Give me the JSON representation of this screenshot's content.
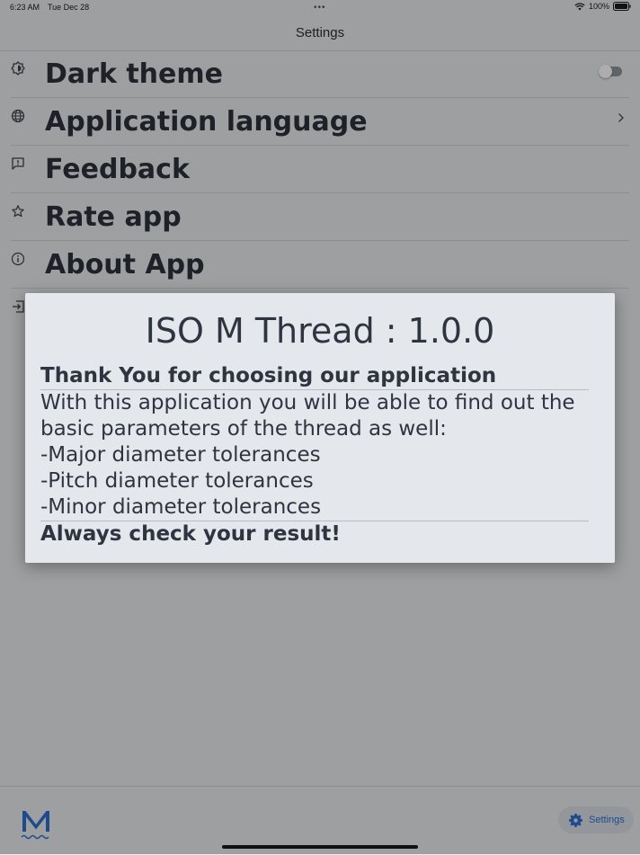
{
  "status_bar": {
    "time": "6:23 AM",
    "date": "Tue Dec 28",
    "dots": "•••",
    "battery": "100%"
  },
  "header": {
    "title": "Settings"
  },
  "settings": {
    "items": [
      {
        "label": "Dark theme",
        "icon": "brightness-icon",
        "control": "toggle",
        "toggle_on": false
      },
      {
        "label": "Application language",
        "icon": "globe-icon",
        "control": "chevron"
      },
      {
        "label": "Feedback",
        "icon": "feedback-icon",
        "control": "none"
      },
      {
        "label": "Rate app",
        "icon": "star-icon",
        "control": "none"
      },
      {
        "label": "About App",
        "icon": "info-icon",
        "control": "none"
      },
      {
        "label": "",
        "icon": "exit-icon",
        "control": "none"
      }
    ]
  },
  "dialog": {
    "title": "ISO M Thread : 1.0.0",
    "heading": "Thank You for choosing our application",
    "intro": "With this application you will be able to find out the basic parameters of the thread as well:",
    "lines": [
      "-Major diameter tolerances",
      "-Pitch diameter tolerances",
      "-Minor diameter tolerances"
    ],
    "footer": "Always check your result!"
  },
  "tab_bar": {
    "logo": "M",
    "settings_label": "Settings"
  },
  "colors": {
    "accent": "#2e6fd0",
    "text": "#2f3540",
    "background": "#e8ebee",
    "dialog_bg": "#e4e7ec"
  }
}
